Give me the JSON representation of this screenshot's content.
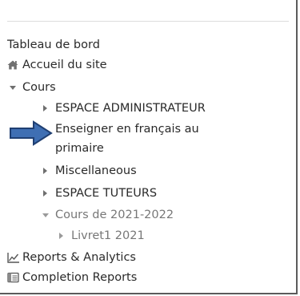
{
  "nav": {
    "dashboard": "Tableau de bord",
    "site_home": "Accueil du site",
    "courses": "Cours",
    "admin_space": "ESPACE ADMINISTRATEUR",
    "teach_line1": "Enseigner en français au",
    "teach_line2": "primaire",
    "misc": "Miscellaneous",
    "tutors_space": "ESPACE TUTEURS",
    "courses_2021": "Cours de 2021-2022",
    "booklet": "Livret1 2021",
    "reports": "Reports & Analytics",
    "completion": "Completion Reports"
  },
  "icons": {
    "home": "home-icon",
    "chart": "line-chart-icon",
    "completion": "report-icon",
    "pointer": "arrow-right-icon"
  },
  "colors": {
    "arrow_fill": "#3f6fb3",
    "arrow_stroke": "#1f3f72",
    "text": "#2a2a2a",
    "muted": "#777777"
  }
}
